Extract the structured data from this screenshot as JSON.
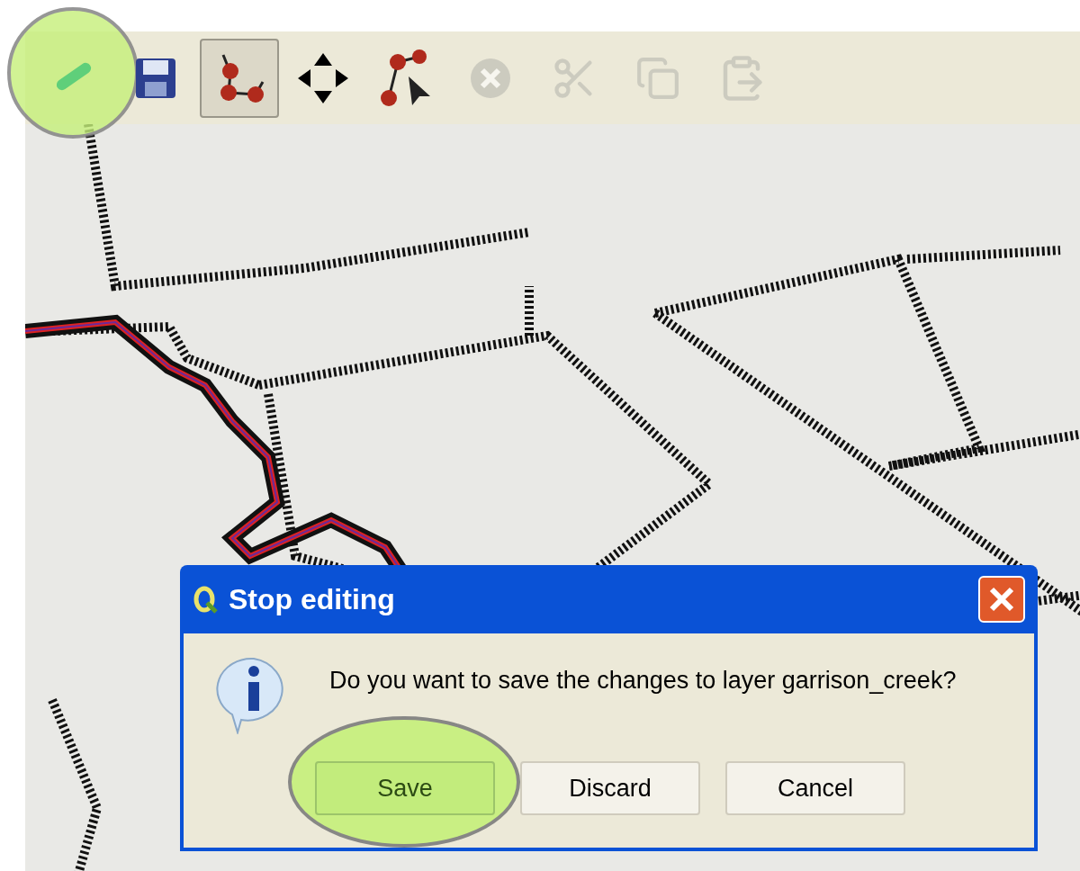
{
  "toolbar": {
    "tools": [
      {
        "kind": "pencil",
        "selected": false,
        "disabled": false,
        "highlighted": true
      },
      {
        "kind": "save",
        "selected": false,
        "disabled": false,
        "highlighted": false
      },
      {
        "kind": "node",
        "selected": true,
        "disabled": false,
        "highlighted": false
      },
      {
        "kind": "move",
        "selected": false,
        "disabled": false,
        "highlighted": false
      },
      {
        "kind": "node-select",
        "selected": false,
        "disabled": false,
        "highlighted": false
      },
      {
        "kind": "delete",
        "selected": false,
        "disabled": true,
        "highlighted": false
      },
      {
        "kind": "cut",
        "selected": false,
        "disabled": true,
        "highlighted": false
      },
      {
        "kind": "copy",
        "selected": false,
        "disabled": true,
        "highlighted": false
      },
      {
        "kind": "paste",
        "selected": false,
        "disabled": true,
        "highlighted": false
      }
    ]
  },
  "dialog": {
    "title": "Stop editing",
    "message": "Do you want to save the changes to layer garrison_creek?",
    "buttons": [
      {
        "label": "Save",
        "highlighted": true
      },
      {
        "label": "Discard",
        "highlighted": false
      },
      {
        "label": "Cancel",
        "highlighted": false
      }
    ]
  }
}
